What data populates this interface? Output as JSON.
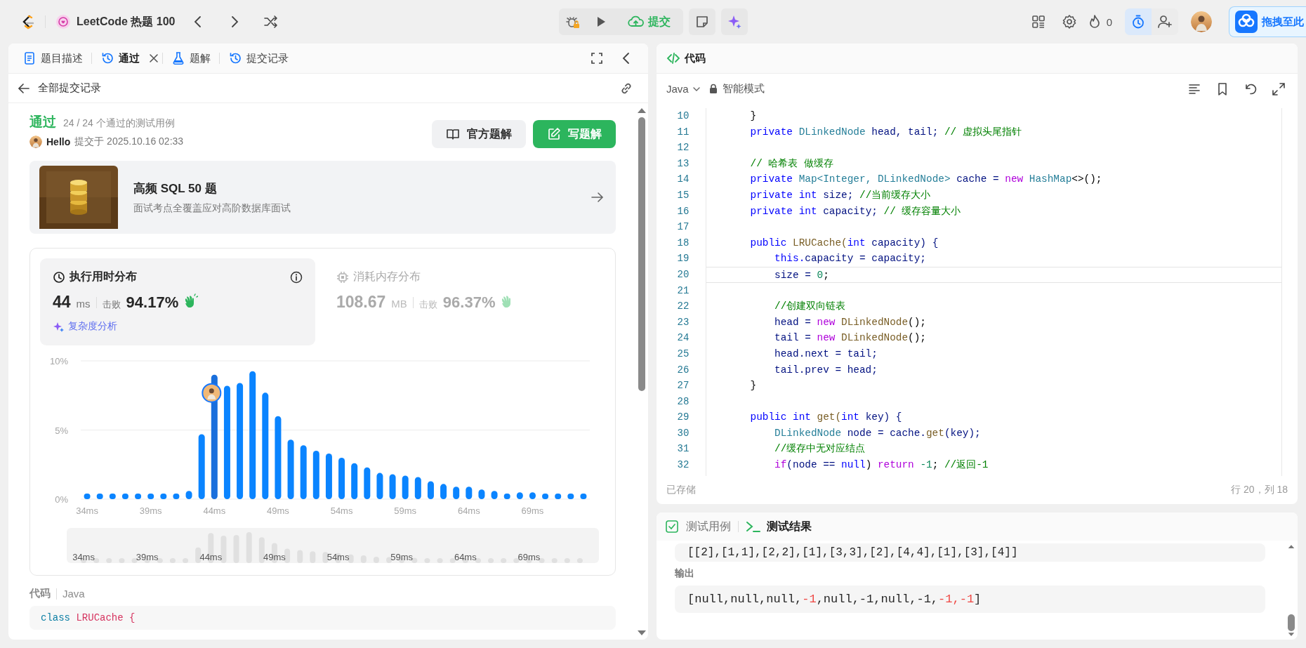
{
  "topbar": {
    "problem_list": "LeetCode 热题 100",
    "submit": "提交",
    "streak": "0",
    "timer_active": true,
    "drag_target": "拖拽至此"
  },
  "left_panel": {
    "tabs": [
      {
        "label": "题目描述",
        "selected": false,
        "closable": false
      },
      {
        "label": "通过",
        "selected": true,
        "closable": true
      },
      {
        "label": "题解",
        "selected": false,
        "closable": false
      },
      {
        "label": "提交记录",
        "selected": false,
        "closable": false
      }
    ],
    "back_link": "全部提交记录",
    "result": {
      "status": "通过",
      "cases": "24 / 24 个通过的测试用例",
      "user": "Hello",
      "submitted": "提交于 2025.10.16 02:33"
    },
    "buttons": [
      {
        "label": "官方题解",
        "kind": "secondary"
      },
      {
        "label": "写题解",
        "kind": "primary"
      }
    ],
    "promo": {
      "title": "高频 SQL 50 题",
      "subtitle": "面试考点全覆盖应对高阶数据库面试"
    },
    "metrics": [
      {
        "title": "执行用时分布",
        "value": "44",
        "unit": "ms",
        "beats_label": "击败",
        "beats": "94.17%",
        "selected": true,
        "link": "复杂度分析"
      },
      {
        "title": "消耗内存分布",
        "value": "108.67",
        "unit": "MB",
        "beats_label": "击败",
        "beats": "96.37%",
        "selected": false
      }
    ],
    "chart_data": {
      "type": "bar",
      "x": [
        34,
        35,
        36,
        37,
        38,
        39,
        40,
        41,
        42,
        43,
        44,
        45,
        46,
        47,
        48,
        49,
        50,
        51,
        52,
        53,
        54,
        55,
        56,
        57,
        58,
        59,
        60,
        61,
        62,
        63,
        64,
        65,
        66,
        67,
        68,
        69,
        70,
        71,
        72,
        73
      ],
      "values": [
        0.4,
        0.4,
        0.4,
        0.4,
        0.4,
        0.4,
        0.4,
        0.4,
        0.6,
        4.7,
        9.0,
        8.2,
        8.4,
        9.25,
        7.7,
        6.0,
        4.3,
        3.9,
        3.5,
        3.3,
        3.0,
        2.6,
        2.3,
        1.9,
        1.8,
        1.7,
        1.6,
        1.3,
        1.1,
        0.9,
        0.9,
        0.7,
        0.6,
        0.4,
        0.5,
        0.5,
        0.4,
        0.4,
        0.4,
        0.4
      ],
      "xlim": [
        33.5,
        73.5
      ],
      "ylim": [
        0,
        10
      ],
      "xticks": [
        {
          "value": 34,
          "label": "34ms"
        },
        {
          "value": 39,
          "label": "39ms"
        },
        {
          "value": 44,
          "label": "44ms"
        },
        {
          "value": 49,
          "label": "49ms"
        },
        {
          "value": 54,
          "label": "54ms"
        },
        {
          "value": 59,
          "label": "59ms"
        },
        {
          "value": 64,
          "label": "64ms"
        },
        {
          "value": 69,
          "label": "69ms"
        }
      ],
      "yticks": [
        {
          "value": 0,
          "label": "0%"
        },
        {
          "value": 5,
          "label": "5%"
        },
        {
          "value": 10,
          "label": "10%"
        }
      ]
    },
    "navigator_labels": [
      "34ms",
      "39ms",
      "44ms",
      "49ms",
      "54ms",
      "59ms",
      "64ms",
      "69ms"
    ],
    "code_header": {
      "title": "代码",
      "language": "Java"
    },
    "code_preview": [
      {
        "kind": "keyword",
        "text": "class "
      },
      {
        "kind": "class",
        "text": "LRUCache {"
      }
    ]
  },
  "editor": {
    "title": "代码",
    "language": "Java",
    "mode": "智能模式",
    "lines": [
      {
        "number": "10",
        "current": false,
        "tokens": [
          {
            "kind": "plain",
            "text": "    }"
          }
        ]
      },
      {
        "number": "11",
        "current": false,
        "tokens": [
          {
            "kind": "keyword",
            "text": "    private "
          },
          {
            "kind": "type",
            "text": "DLinkedNode "
          },
          {
            "kind": "variable",
            "text": "head, tail; "
          },
          {
            "kind": "comment",
            "text": "// 虚拟头尾指针"
          }
        ]
      },
      {
        "number": "12",
        "current": false
      },
      {
        "number": "13",
        "current": false,
        "tokens": [
          {
            "kind": "comment",
            "text": "    // 哈希表 做缓存"
          }
        ]
      },
      {
        "number": "14",
        "current": false,
        "tokens": [
          {
            "kind": "keyword",
            "text": "    private "
          },
          {
            "kind": "type",
            "text": "Map<Integer, DLinkedNode> "
          },
          {
            "kind": "variable",
            "text": "cache = "
          },
          {
            "kind": "control",
            "text": "new "
          },
          {
            "kind": "type",
            "text": "HashMap"
          },
          {
            "kind": "plain",
            "text": "<>();"
          }
        ]
      },
      {
        "number": "15",
        "current": false,
        "tokens": [
          {
            "kind": "keyword",
            "text": "    private int "
          },
          {
            "kind": "variable",
            "text": "size; "
          },
          {
            "kind": "comment",
            "text": "//当前缓存大小"
          }
        ]
      },
      {
        "number": "16",
        "current": false,
        "tokens": [
          {
            "kind": "keyword",
            "text": "    private int "
          },
          {
            "kind": "variable",
            "text": "capacity; "
          },
          {
            "kind": "comment",
            "text": "// 缓存容量大小"
          }
        ]
      },
      {
        "number": "17",
        "current": false
      },
      {
        "number": "18",
        "current": false,
        "tokens": [
          {
            "kind": "keyword",
            "text": "    public "
          },
          {
            "kind": "function",
            "text": "LRUCache("
          },
          {
            "kind": "keyword",
            "text": "int "
          },
          {
            "kind": "variable",
            "text": "capacity) {"
          }
        ]
      },
      {
        "number": "19",
        "current": false,
        "tokens": [
          {
            "kind": "keyword",
            "text": "        this."
          },
          {
            "kind": "variable",
            "text": "capacity = capacity;"
          }
        ]
      },
      {
        "number": "20",
        "current": true,
        "tokens": [
          {
            "kind": "variable",
            "text": "        size = "
          },
          {
            "kind": "number",
            "text": "0"
          },
          {
            "kind": "plain",
            "text": ";"
          }
        ]
      },
      {
        "number": "21",
        "current": false
      },
      {
        "number": "22",
        "current": false,
        "tokens": [
          {
            "kind": "comment",
            "text": "        //创建双向链表"
          }
        ]
      },
      {
        "number": "23",
        "current": false,
        "tokens": [
          {
            "kind": "variable",
            "text": "        head = "
          },
          {
            "kind": "control",
            "text": "new "
          },
          {
            "kind": "function",
            "text": "DLinkedNode"
          },
          {
            "kind": "plain",
            "text": "();"
          }
        ]
      },
      {
        "number": "24",
        "current": false,
        "tokens": [
          {
            "kind": "variable",
            "text": "        tail = "
          },
          {
            "kind": "control",
            "text": "new "
          },
          {
            "kind": "function",
            "text": "DLinkedNode"
          },
          {
            "kind": "plain",
            "text": "();"
          }
        ]
      },
      {
        "number": "25",
        "current": false,
        "tokens": [
          {
            "kind": "variable",
            "text": "        head.next = tail;"
          }
        ]
      },
      {
        "number": "26",
        "current": false,
        "tokens": [
          {
            "kind": "variable",
            "text": "        tail.prev = head;"
          }
        ]
      },
      {
        "number": "27",
        "current": false,
        "tokens": [
          {
            "kind": "plain",
            "text": "    }"
          }
        ]
      },
      {
        "number": "28",
        "current": false
      },
      {
        "number": "29",
        "current": false,
        "tokens": [
          {
            "kind": "keyword",
            "text": "    public int "
          },
          {
            "kind": "function",
            "text": "get("
          },
          {
            "kind": "keyword",
            "text": "int "
          },
          {
            "kind": "variable",
            "text": "key) {"
          }
        ]
      },
      {
        "number": "30",
        "current": false,
        "tokens": [
          {
            "kind": "type",
            "text": "        DLinkedNode "
          },
          {
            "kind": "variable",
            "text": "node = cache."
          },
          {
            "kind": "function",
            "text": "get"
          },
          {
            "kind": "variable",
            "text": "(key);"
          }
        ]
      },
      {
        "number": "31",
        "current": false,
        "tokens": [
          {
            "kind": "comment",
            "text": "        //缓存中无对应结点"
          }
        ]
      },
      {
        "number": "32",
        "current": false,
        "tokens": [
          {
            "kind": "control",
            "text": "        if"
          },
          {
            "kind": "variable",
            "text": "(node == "
          },
          {
            "kind": "keyword",
            "text": "null"
          },
          {
            "kind": "plain",
            "text": ") "
          },
          {
            "kind": "control",
            "text": "return "
          },
          {
            "kind": "number",
            "text": "-1"
          },
          {
            "kind": "plain",
            "text": "; "
          },
          {
            "kind": "comment",
            "text": "//返回-1"
          }
        ]
      }
    ],
    "saved": "已存储",
    "cursor": "行 20，列 18"
  },
  "console": {
    "tabs": [
      {
        "label": "测试用例",
        "selected": false
      },
      {
        "label": "测试结果",
        "selected": true
      }
    ],
    "input_line": "[[2],[1,1],[2,2],[1],[3,3],[2],[4,4],[1],[3],[4]]",
    "output_label": "输出",
    "output": [
      {
        "text": "[null,null,null,",
        "diff": false
      },
      {
        "text": "-1",
        "diff": true
      },
      {
        "text": ",null,-1,null,-1,",
        "diff": false
      },
      {
        "text": "-1,-1",
        "diff": true
      },
      {
        "text": "]",
        "diff": false
      }
    ]
  }
}
